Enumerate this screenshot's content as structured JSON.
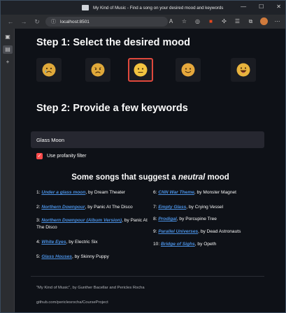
{
  "window": {
    "title": "My Kind of Music - Find a song on your desired mood and keywords",
    "controls": [
      "—",
      "☐",
      "✕"
    ]
  },
  "browser": {
    "url": "localhost:8501",
    "back_icon": "←",
    "forward_icon": "→",
    "reload_icon": "↻"
  },
  "step1": {
    "title": "Step 1: Select the desired mood"
  },
  "moods": [
    {
      "name": "very-sad",
      "color": "#e0a93a",
      "selected": false
    },
    {
      "name": "sad",
      "color": "#e0a93a",
      "selected": false
    },
    {
      "name": "neutral",
      "color": "#f2c440",
      "selected": true
    },
    {
      "name": "happy",
      "color": "#e6a83c",
      "selected": false
    },
    {
      "name": "very-happy",
      "color": "#e8b33d",
      "selected": false
    }
  ],
  "step2": {
    "title": "Step 2: Provide a few keywords"
  },
  "keywords": {
    "value": "Glass Moon"
  },
  "profanity": {
    "label": "Use profanity filter",
    "checked": true,
    "check": "✓"
  },
  "results": {
    "title_prefix": "Some songs that suggest a ",
    "mood_word": "neutral",
    "title_suffix": " mood",
    "left": [
      {
        "num": "1: ",
        "title": "Under a glass moon",
        "artist": ", by Dream Theater"
      },
      {
        "num": "2: ",
        "title": "Northern Downpour",
        "artist": ", by Panic At The Disco"
      },
      {
        "num": "3: ",
        "title": "Northern Downpour (Album Version)",
        "artist": ", by Panic At The Disco"
      },
      {
        "num": "4: ",
        "title": "White Eyes",
        "artist": ", by Electric Six"
      },
      {
        "num": "5: ",
        "title": "Glass Houses",
        "artist": ", by Skinny Puppy"
      }
    ],
    "right": [
      {
        "num": "6: ",
        "title": "CNN War Theme",
        "artist": ", by Monster Magnet"
      },
      {
        "num": "7: ",
        "title": "Empty Glass",
        "artist": ", by Crying Vessel"
      },
      {
        "num": "8: ",
        "title": "Prodigal",
        "artist": ", by Porcupine Tree"
      },
      {
        "num": "9: ",
        "title": "Parallel Universes",
        "artist": ", by Dead Astronauts"
      },
      {
        "num": "10: ",
        "title": "Bridge of Sighs",
        "artist": ", by Opeth"
      }
    ]
  },
  "footer": {
    "credit": "\"My Kind of Music\", by Gunther Bacellar and Pericles Rocha",
    "repo": "github.com/periclesrocha/CourseProject"
  }
}
